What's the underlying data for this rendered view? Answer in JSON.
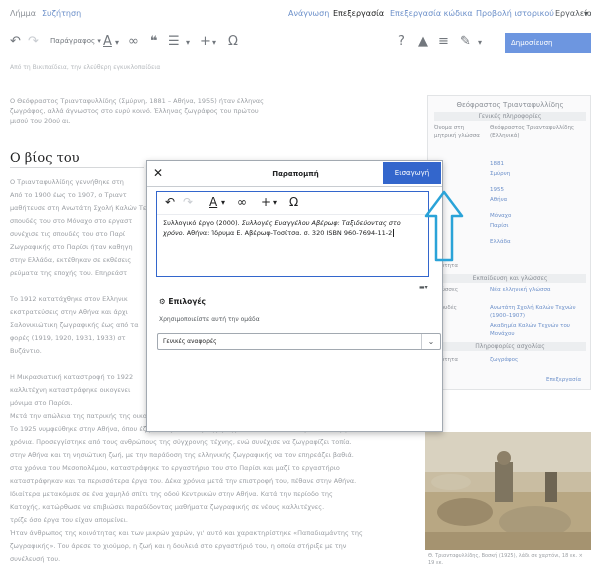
{
  "tabs": {
    "article": "Λήμμα",
    "talk": "Συζήτηση",
    "read": "Ανάγνωση",
    "edit": "Επεξεργασία",
    "edit_source": "Επεξεργασία κώδικα",
    "history": "Προβολή ιστορικού",
    "tools": "Εργαλεία"
  },
  "toolbar": {
    "paragraph": "Παράγραφος",
    "publish": "Δημοσίευση αλλαγών..."
  },
  "subline": "Από τη Βικιπαίδεια, την ελεύθερη εγκυκλοπαίδεια",
  "article": {
    "intro": "Ο Θεόφραστος Τριανταφυλλίδης (Σμύρνη, 1881 – Αθήνα, 1955) ήταν έλληνας ζωγράφος, αλλά άγνωστος στο ευρύ κοινό. Έλληνας ζωγράφος του πρώτου μισού του 20ού αι.",
    "heading": "Ο βίος του",
    "lines": [
      "Ο Τριανταφυλλίδης γεννήθηκε στη",
      "Από το 1900 έως το 1907, ο Τριαντ",
      "μαθήτευσε στη Ανωτάτη Σχολή Καλών Τε",
      "σπουδές του στο Μόναχο στο εργαστ",
      "συνέχισε τις σπουδές του στο Παρί",
      "Ζωγραφικής στο Παρίσι ήταν καθηγη",
      "στην Ελλάδα, εκτέθηκαν σε εκθέσεις",
      "ρεύματα της εποχής του. Επηρεάστ",
      "",
      "Το 1912 κατατάχθηκε στον Ελληνικ",
      "εκστρατεύσεις στην Αθήνα και άρχι",
      "Σαλονικιώτικη ζωγραφικής έως από τα",
      "φορές (1919, 1920, 1931, 1933) στ",
      "Βυζάντιο.",
      "",
      "Η Μικρασιατική καταστροφή το 1922",
      "καλλιτέχνη καταστράφηκε οικογενει",
      "μόνιμα στο Παρίσι.",
      "Μετά την απώλεια της πατρικής της οικογένειας ο Τριανταφυλλίδης εγκαταστάθηκε στην Αθήνα.",
      "Το 1925 νυμφεύθηκε στην Αθήνα, όπου έζησε έως το τέλος της ζωής του, αναπτύσσοντας πλούσιο έργο.",
      "χρόνια. Προσεγγίστηκε από τους ανθρώπους της σύγχρονης τέχνης, ενώ συνέχισε να ζωγραφίζει τοπία.",
      "στην Αθήνα και τη νησιώτικη ζωή, με την παράδοση της ελληνικής ζωγραφικής να τον επηρεάζει βαθιά.",
      "στα χρόνια του Μεσοπολέμου, καταστράφηκε το εργαστήριο του στο Παρίσι και μαζί το εργαστήριο",
      "καταστράφηκαν και τα περισσότερα έργα του. Δέκα χρόνια μετά την επιστροφή του, πέθανε στην Αθήνα.",
      "Ιδιαίτερα μετακόμισε σε ένα χαμηλό σπίτι της οδού Κεντρικών στην Αθήνα. Κατά την περίοδο της",
      "Κατοχής, κατώρθωσε να επιβιώσει παραδίδοντας μαθήματα ζωγραφικής σε νέους καλλιτέχνες.",
      "τρίζε όσο έργα του είχαν απομείνει.",
      "Ήταν άνθρωπος της κοινότητας και των μικρών χαρών, γι' αυτό και χαρακτηρίστηκε «Παπαδιαμάντης της",
      "ζωγραφικής». Του άρεσε το χιούμορ, η ζωή και η δουλειά στο εργαστήριό του, η οποία στήριξε με την",
      "συνέλευσή του."
    ]
  },
  "infobox": {
    "title": "Θεόφραστος Τριανταφυλλίδης",
    "section_general": "Γενικές πληροφορίες",
    "native_name_label": "Όνομα στη μητρική γλώσσα",
    "native_name_value": "Θεόφραστος Τριανταφυλλίδης (Ελληνικά)",
    "rows": [
      {
        "label": "",
        "value": "1881"
      },
      {
        "label": "",
        "value": "Σμύρνη"
      },
      {
        "label": "",
        "value": "1955"
      },
      {
        "label": "",
        "value": "Αθήνα"
      },
      {
        "label": "",
        "value": "Μόναχο"
      },
      {
        "label": "",
        "value": "Παρίσι"
      },
      {
        "label": "",
        "value": "Ελλάδα"
      }
    ],
    "occupation_label": "Ιδιότητα",
    "section_education": "Εκπαίδευση και γλώσσες",
    "languages_label": "Γλώσσες",
    "languages_value": "Νέα ελληνική γλώσσα",
    "teachers_label": "Σπουδές",
    "teachers_value": "Ανωτάτη Σχολή Καλών Τεχνών (1900–1907)",
    "teachers_value2": "Ακαδημία Καλών Τεχνών του Μονάχου",
    "section_career": "Πληροφορίες ασχολίας",
    "job_label": "Ιδιότητα",
    "job_value": "ζωγράφος",
    "footer_link": "Επεξεργασία"
  },
  "painting_caption": "Θ. Τριανταφυλλίδης, Βοσκή (1925), λάδι σε χαρτόνι, 18 εκ. × 19 εκ.",
  "dialog": {
    "title": "Παραπομπή",
    "insert": "Εισαγωγή",
    "citation_part1": "Συλλογικό έργο (2000). ",
    "citation_italic": "Συλλογές Ευαγγέλου Αβέρωφ: Ταξιδεύοντας στο χρόνο",
    "citation_part2": ". Αθήνα: Ίδρυμα Ε. Αβέρωφ-Τοσίτσα. σ. 320 ISBN 960-7694-11-2",
    "options": "Επιλογές",
    "group_hint": "Χρησιμοποιείστε αυτή την ομάδα",
    "group_value": "Γενικές αναφορές"
  },
  "colors": {
    "accent": "#3366cc",
    "publish": "#6d96e0",
    "annotation_arrow": "#2aa3d8"
  }
}
